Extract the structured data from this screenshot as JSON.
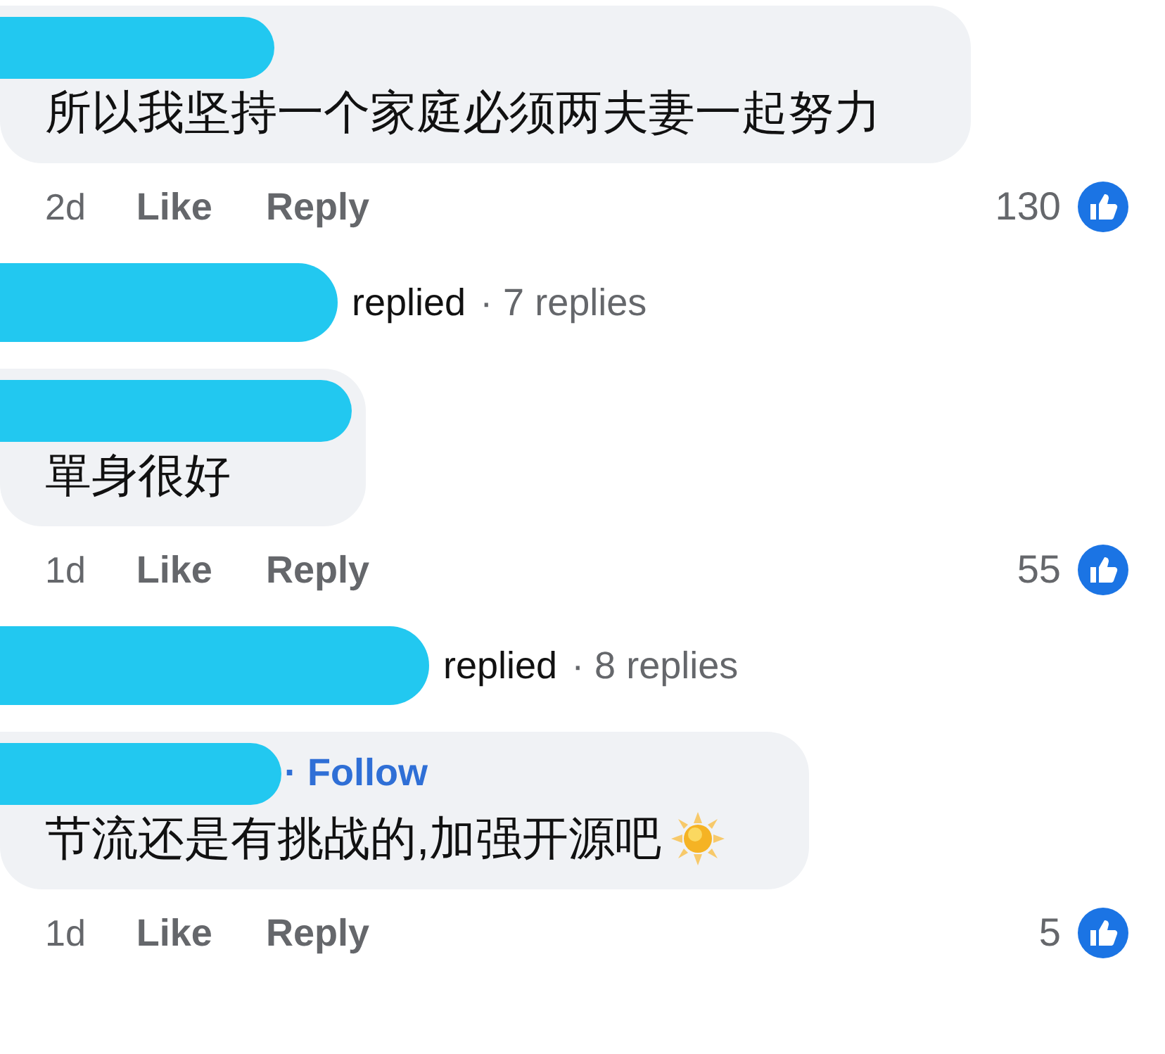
{
  "items": [
    {
      "kind": "comment",
      "text": "所以我坚持一个家庭必须两夫妻一起努力",
      "emoji": false,
      "time": "2d",
      "like": "Like",
      "reply": "Reply",
      "count": "130"
    },
    {
      "kind": "replies",
      "replied": "replied",
      "replies": "· 7 replies"
    },
    {
      "kind": "comment",
      "text": "單身很好",
      "emoji": false,
      "time": "1d",
      "like": "Like",
      "reply": "Reply",
      "count": "55"
    },
    {
      "kind": "replies",
      "replied": "replied",
      "replies": "· 8 replies"
    },
    {
      "kind": "comment",
      "follow": "· Follow",
      "text": "节流还是有挑战的,加强开源吧",
      "emoji": true,
      "time": "1d",
      "like": "Like",
      "reply": "Reply",
      "count": "5"
    }
  ]
}
